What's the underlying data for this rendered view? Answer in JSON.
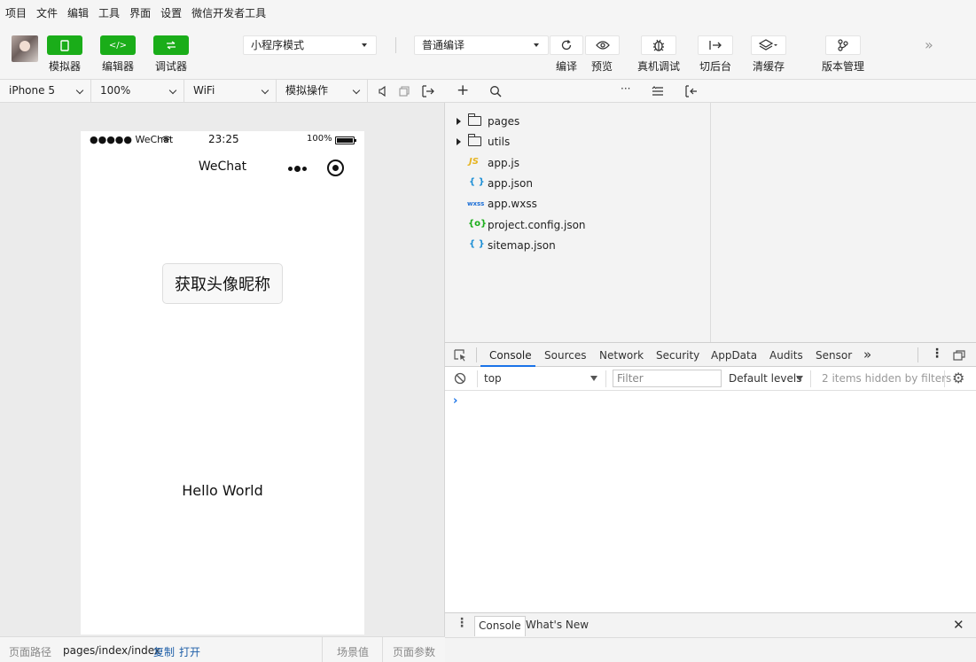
{
  "menu": [
    "项目",
    "文件",
    "编辑",
    "工具",
    "界面",
    "设置",
    "微信开发者工具"
  ],
  "toolbar": {
    "simulator_label": "模拟器",
    "editor_label": "编辑器",
    "debugger_label": "调试器",
    "mode_select": "小程序模式",
    "compile_select": "普通编译",
    "compile_label": "编译",
    "preview_label": "预览",
    "remote_debug_label": "真机调试",
    "background_label": "切后台",
    "clear_cache_label": "清缓存",
    "version_label": "版本管理"
  },
  "simbar": {
    "device": "iPhone 5",
    "zoom": "100%",
    "network": "WiFi",
    "operation": "模拟操作"
  },
  "phone": {
    "signal": "●●●●● WeChat",
    "time": "23:25",
    "battery": "100%",
    "title": "WeChat",
    "button_label": "获取头像昵称",
    "hello_text": "Hello World"
  },
  "footer": {
    "path_label": "页面路径",
    "path_value": "pages/index/index",
    "copy_link": "复制",
    "open_link": "打开",
    "scene_label": "场景值",
    "params_label": "页面参数"
  },
  "files": [
    {
      "type": "folder",
      "name": "pages"
    },
    {
      "type": "folder",
      "name": "utils"
    },
    {
      "type": "js",
      "icon": "JS",
      "name": "app.js",
      "color": "#e6b422"
    },
    {
      "type": "json",
      "icon": "{ }",
      "name": "app.json",
      "color": "#1d8fd6"
    },
    {
      "type": "wxss",
      "icon": "wxss",
      "name": "app.wxss",
      "color": "#1d6fd6"
    },
    {
      "type": "config",
      "icon": "{o}",
      "name": "project.config.json",
      "color": "#1aad19"
    },
    {
      "type": "json",
      "icon": "{ }",
      "name": "sitemap.json",
      "color": "#1d8fd6"
    }
  ],
  "devtools": {
    "tabs": [
      "Console",
      "Sources",
      "Network",
      "Security",
      "AppData",
      "Audits",
      "Sensor"
    ],
    "active_tab": "Console",
    "context": "top",
    "filter_placeholder": "Filter",
    "levels": "Default levels",
    "hidden_text": "2 items hidden by filters",
    "drawer_tabs": [
      "Console",
      "What's New"
    ]
  },
  "colors": {
    "accent_green": "#1aad19",
    "devtools_blue": "#1a73e8"
  }
}
